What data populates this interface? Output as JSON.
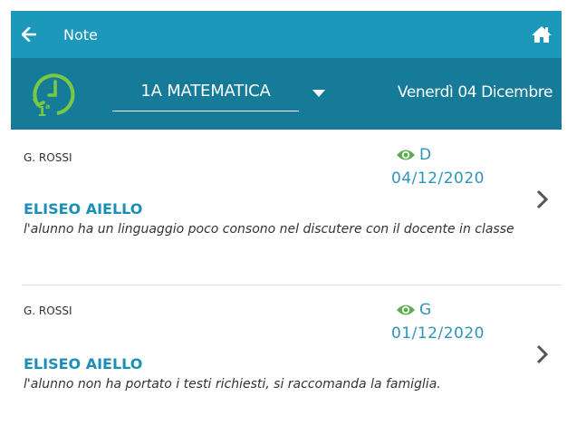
{
  "header": {
    "title": "Note",
    "back_icon": "arrow-left-icon",
    "home_icon": "home-icon",
    "bg_color": "#1c98bb"
  },
  "subheader": {
    "bg_color": "#157b98",
    "clock_icon": "lesson-hour-clock-icon",
    "selected_class": "1A MATEMATICA",
    "date": "Venerdì 04 Dicembre",
    "accent_color": "#7ac943"
  },
  "notes": [
    {
      "teacher": "G. ROSSI",
      "visibility": "D",
      "date": "04/12/2020",
      "student": "ELISEO AIELLO",
      "text": "l'alunno ha un linguaggio poco consono nel discutere con il docente in classe"
    },
    {
      "teacher": "G. ROSSI",
      "visibility": "G",
      "date": "01/12/2020",
      "student": "ELISEO AIELLO",
      "text": "l'alunno non ha portato i testi richiesti, si raccomanda la famiglia."
    }
  ],
  "colors": {
    "link_blue": "#1c8fb6",
    "eye_green": "#5aaf4b",
    "divider": "#e2e2e2"
  }
}
